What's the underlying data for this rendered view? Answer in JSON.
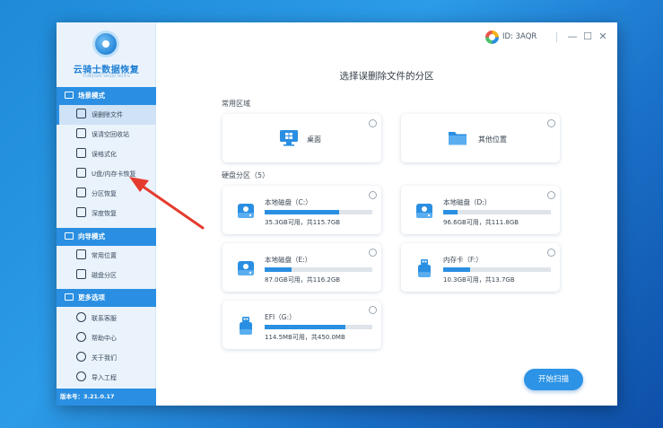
{
  "app": {
    "name": "云骑士数据恢复",
    "subtitle": "YUNQISHI SHUJU HUIFU",
    "version": "版本号：3.21.0.17",
    "user_id": "ID: 3AQR"
  },
  "window_controls": {
    "minimize": "—",
    "maximize": "☐",
    "close": "✕"
  },
  "sidebar": {
    "sections": [
      {
        "title": "场景模式",
        "items": [
          {
            "label": "误删除文件",
            "icon": "folder-scan-icon",
            "active": true
          },
          {
            "label": "误清空回收站",
            "icon": "recycle-bin-icon"
          },
          {
            "label": "误格式化",
            "icon": "format-icon"
          },
          {
            "label": "U盘/内存卡恢复",
            "icon": "usb-card-icon"
          },
          {
            "label": "分区恢复",
            "icon": "partition-icon"
          },
          {
            "label": "深度恢复",
            "icon": "deep-scan-icon"
          }
        ]
      },
      {
        "title": "向导模式",
        "items": [
          {
            "label": "常用位置",
            "icon": "location-icon"
          },
          {
            "label": "磁盘分区",
            "icon": "disk-icon"
          }
        ]
      },
      {
        "title": "更多选项",
        "items": [
          {
            "label": "联系客服",
            "icon": "headset-icon"
          },
          {
            "label": "帮助中心",
            "icon": "help-icon"
          },
          {
            "label": "关于我们",
            "icon": "info-icon"
          },
          {
            "label": "导入工程",
            "icon": "import-icon"
          }
        ]
      }
    ]
  },
  "main": {
    "title": "选择误删除文件的分区",
    "common_label": "常用区域",
    "common_locations": [
      {
        "label": "桌面",
        "icon": "desktop-icon"
      },
      {
        "label": "其他位置",
        "icon": "folder-icon"
      }
    ],
    "disk_label": "硬盘分区（5）",
    "disks": [
      {
        "name": "本地磁盘（C:）",
        "info": "35.3GB可用，共115.7GB",
        "used_percent": 69,
        "icon": "hdd-icon"
      },
      {
        "name": "本地磁盘（D:）",
        "info": "96.6GB可用，共111.8GB",
        "used_percent": 13,
        "icon": "hdd-icon"
      },
      {
        "name": "本地磁盘（E:）",
        "info": "87.0GB可用，共116.2GB",
        "used_percent": 25,
        "icon": "hdd-icon"
      },
      {
        "name": "内存卡（F:）",
        "info": "10.3GB可用，共13.7GB",
        "used_percent": 25,
        "icon": "usb-icon"
      },
      {
        "name": "EFI（G:）",
        "info": "114.5MB可用，共450.0MB",
        "used_percent": 75,
        "icon": "usb-icon"
      }
    ],
    "scan_button": "开始扫描"
  },
  "colors": {
    "accent": "#2a8fe2",
    "annotation_arrow": "#e53b2e"
  }
}
